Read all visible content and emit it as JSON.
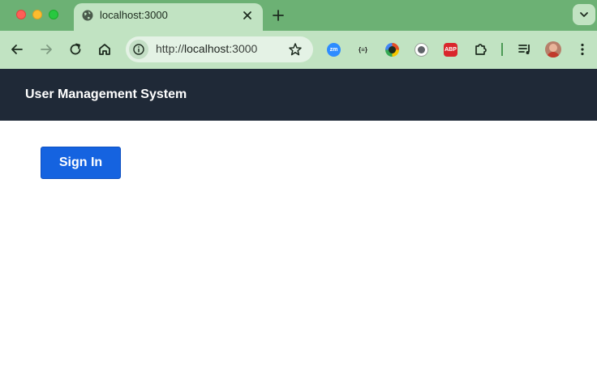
{
  "browser": {
    "tab": {
      "title": "localhost:3000",
      "favicon": "globe-icon"
    },
    "address_bar": {
      "scheme": "http://",
      "host": "localhost",
      "port": ":3000"
    },
    "extensions": [
      {
        "name": "zoom-extension-icon",
        "label": "zm",
        "color": "#2d8cff"
      },
      {
        "name": "json-extension-icon",
        "label": "{≡}",
        "color": "#222222"
      },
      {
        "name": "color-picker-extension-icon",
        "label": "",
        "color": "#e44d26"
      },
      {
        "name": "bookmark-extension-icon",
        "label": "",
        "color": "#5f6368"
      },
      {
        "name": "adblock-plus-extension-icon",
        "label": "ABP",
        "color": "#d9262c"
      }
    ],
    "colors": {
      "frame": "#6cb174",
      "toolbar": "#c1e3c2"
    }
  },
  "app": {
    "title": "User Management System",
    "sign_in_label": "Sign In",
    "colors": {
      "header": "#1f2937",
      "primary": "#1563e0"
    }
  }
}
